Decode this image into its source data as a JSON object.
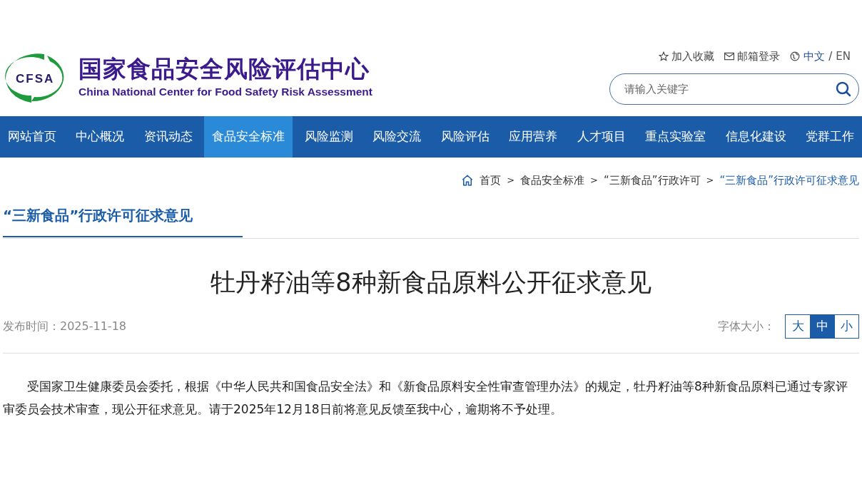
{
  "header": {
    "logo_text": "CFSA",
    "title": "国家食品安全风险评估中心",
    "subtitle": "China National Center for Food Safety Risk Assessment"
  },
  "top_links": {
    "favorite": "加入收藏",
    "mail": "邮箱登录",
    "languages": [
      {
        "label": "中文",
        "selected": true
      },
      {
        "label": "EN",
        "selected": false
      }
    ],
    "separator": "/"
  },
  "search": {
    "placeholder": "请输入关键字"
  },
  "nav": [
    {
      "label": "网站首页",
      "selected": false
    },
    {
      "label": "中心概况",
      "selected": false
    },
    {
      "label": "资讯动态",
      "selected": false
    },
    {
      "label": "食品安全标准",
      "selected": true
    },
    {
      "label": "风险监测",
      "selected": false
    },
    {
      "label": "风险交流",
      "selected": false
    },
    {
      "label": "风险评估",
      "selected": false
    },
    {
      "label": "应用营养",
      "selected": false
    },
    {
      "label": "人才项目",
      "selected": false
    },
    {
      "label": "重点实验室",
      "selected": false
    },
    {
      "label": "信息化建设",
      "selected": false
    },
    {
      "label": "党群工作",
      "selected": false
    }
  ],
  "breadcrumb": [
    {
      "label": "首页",
      "current": false
    },
    {
      "label": "食品安全标准",
      "current": false
    },
    {
      "label": "“三新食品”行政许可",
      "current": false
    },
    {
      "label": "“三新食品”行政许可征求意见",
      "current": true
    }
  ],
  "breadcrumb_separator": ">",
  "section_title": "“三新食品”行政许可征求意见",
  "article": {
    "title": "牡丹籽油等8种新食品原料公开征求意见",
    "date": "发布时间：2025-11-18",
    "font_size_label": "字体大小：",
    "font_sizes": [
      {
        "label": "大",
        "selected": false
      },
      {
        "label": "中",
        "selected": true
      },
      {
        "label": "小",
        "selected": false
      }
    ],
    "body": "受国家卫生健康委员会委托，根据《中华人民共和国食品安全法》和《新食品原料安全性审查管理办法》的规定，牡丹籽油等8种新食品原料已通过专家评审委员会技术审查，现公开征求意见。请于2025年12月18日前将意见反馈至我中心，逾期将不予处理。"
  }
}
